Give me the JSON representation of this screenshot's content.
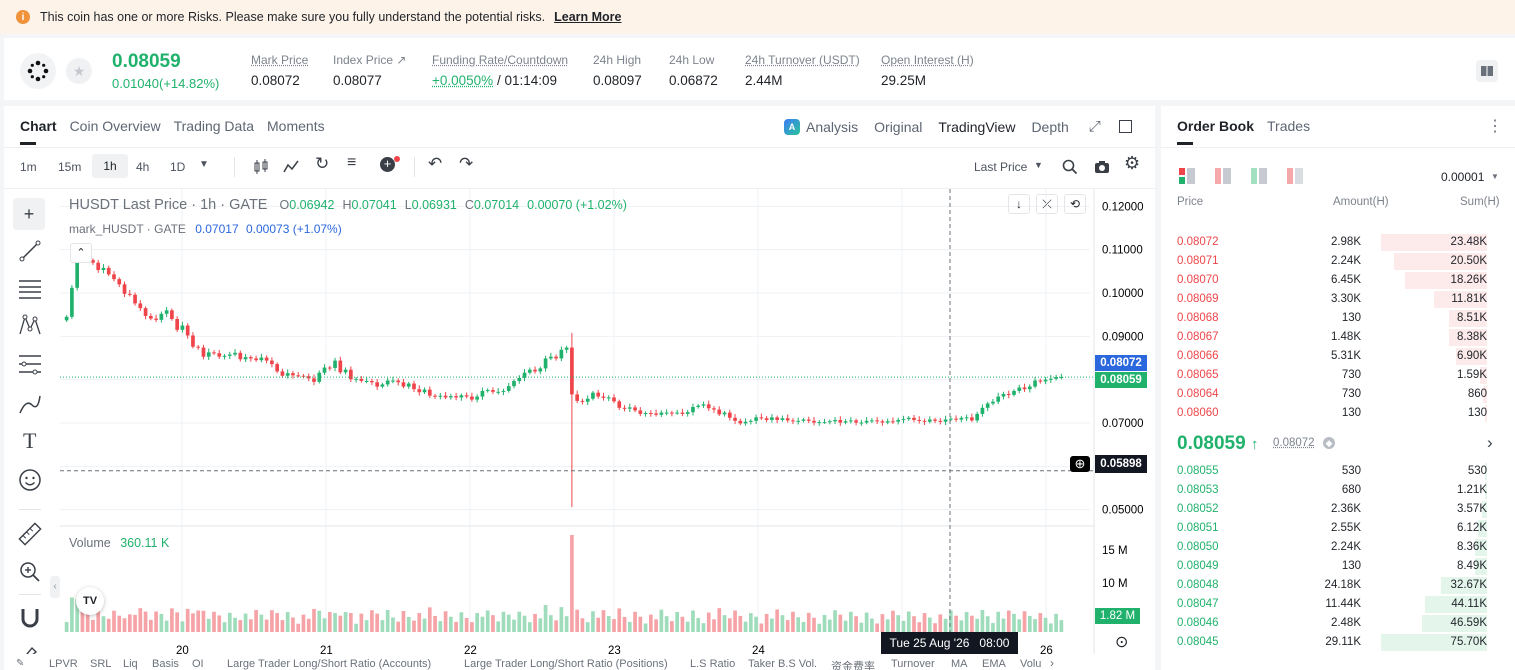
{
  "risk": {
    "text": "This coin has one or more Risks. Please make sure you fully understand the potential risks.",
    "link": "Learn More"
  },
  "ticker": {
    "last": "0.08059",
    "change": "0.01040(+14.82%)",
    "stats": [
      {
        "label": "Mark Price",
        "value": "0.08072"
      },
      {
        "label": "Index Price ↗",
        "value": "0.08077"
      },
      {
        "label": "Funding Rate/Countdown",
        "value": "+0.0050%",
        "value2": " / 01:14:09"
      },
      {
        "label": "24h High",
        "value": "0.08097"
      },
      {
        "label": "24h Low",
        "value": "0.06872"
      },
      {
        "label": "24h Turnover (USDT)",
        "value": "2.44M"
      },
      {
        "label": "Open Interest (H)",
        "value": "29.25M"
      }
    ]
  },
  "tabs": {
    "chart": "Chart",
    "overview": "Coin Overview",
    "trading": "Trading Data",
    "moments": "Moments",
    "analysis": "Analysis",
    "original": "Original",
    "tradingview": "TradingView",
    "depth": "Depth"
  },
  "toolbar": {
    "intervals": [
      "1m",
      "15m",
      "1h",
      "4h",
      "1D"
    ],
    "price_type": "Last Price"
  },
  "chart": {
    "symbol": "HUSDT Last Price · 1h · GATE",
    "o": "0.06942",
    "h": "0.07041",
    "l": "0.06931",
    "c": "0.07014",
    "change": "0.00070 (+1.02%)",
    "mark_label": "mark_HUSDT · GATE",
    "mark_val": "0.07017",
    "mark_change": "0.00073 (+1.07%)",
    "mark_tag": "0.08072",
    "last_tag": "0.08059",
    "cross_tag": "0.05898",
    "time_tag": "Tue 25 Aug '26   08:00",
    "volume_label": "Volume",
    "volume_val": "360.11 K",
    "vol_tag": "1.82 M"
  },
  "chart_data": {
    "type": "candlestick",
    "x_ticks": [
      "20",
      "21",
      "22",
      "23",
      "24",
      "26"
    ],
    "y_ticks": [
      "0.12000",
      "0.11000",
      "0.10000",
      "0.09000",
      "0.07000",
      "0.05000"
    ],
    "ylim": [
      0.046,
      0.124
    ],
    "closes": [
      0.0945,
      0.1012,
      0.1092,
      0.1084,
      0.1076,
      0.107,
      0.1053,
      0.1058,
      0.1043,
      0.1032,
      0.102,
      0.0998,
      0.0996,
      0.0976,
      0.0965,
      0.0947,
      0.0941,
      0.0938,
      0.0952,
      0.096,
      0.094,
      0.0915,
      0.0925,
      0.0902,
      0.0876,
      0.0874,
      0.0853,
      0.0863,
      0.0861,
      0.0853,
      0.0855,
      0.0858,
      0.0862,
      0.0847,
      0.0852,
      0.0849,
      0.0845,
      0.0851,
      0.0844,
      0.0836,
      0.0819,
      0.0809,
      0.0815,
      0.081,
      0.0809,
      0.0808,
      0.0803,
      0.0795,
      0.0816,
      0.0828,
      0.0827,
      0.0844,
      0.0817,
      0.0823,
      0.0801,
      0.0802,
      0.0797,
      0.0797,
      0.0794,
      0.0784,
      0.0789,
      0.0798,
      0.0798,
      0.0794,
      0.0784,
      0.0791,
      0.0778,
      0.0771,
      0.0777,
      0.0763,
      0.0762,
      0.0763,
      0.0759,
      0.0762,
      0.0759,
      0.0764,
      0.0761,
      0.0754,
      0.0761,
      0.0774,
      0.0776,
      0.0772,
      0.0772,
      0.0774,
      0.0785,
      0.0797,
      0.0804,
      0.0816,
      0.0823,
      0.0819,
      0.0826,
      0.0849,
      0.0853,
      0.0849,
      0.0869,
      0.0874,
      0.0766,
      0.0751,
      0.0749,
      0.0756,
      0.077,
      0.0761,
      0.0758,
      0.0759,
      0.075,
      0.0735,
      0.0733,
      0.0736,
      0.0729,
      0.0721,
      0.0723,
      0.0722,
      0.0719,
      0.0724,
      0.0724,
      0.0723,
      0.0724,
      0.0721,
      0.0725,
      0.0737,
      0.074,
      0.0743,
      0.0734,
      0.0731,
      0.072,
      0.0724,
      0.0712,
      0.0705,
      0.0699,
      0.0703,
      0.0705,
      0.0713,
      0.0711,
      0.0707,
      0.0713,
      0.0707,
      0.0711,
      0.0706,
      0.0704,
      0.0705,
      0.0708,
      0.0705,
      0.0701,
      0.0702,
      0.0702,
      0.0704,
      0.0707,
      0.0701,
      0.0704,
      0.0706,
      0.0701,
      0.0701,
      0.0705,
      0.0706,
      0.0704,
      0.0701,
      0.0704,
      0.0703,
      0.0707,
      0.0709,
      0.0712,
      0.0707,
      0.0705,
      0.0703,
      0.0708,
      0.0705,
      0.0703,
      0.0708,
      0.071,
      0.0708,
      0.0712,
      0.0713,
      0.0706,
      0.0721,
      0.0735,
      0.0745,
      0.0749,
      0.0761,
      0.0767,
      0.0765,
      0.0774,
      0.0782,
      0.0778,
      0.0784,
      0.0798,
      0.0796,
      0.08,
      0.0802,
      0.0806,
      0.0806
    ]
  },
  "orderbook": {
    "tab": "Order Book",
    "trades": "Trades",
    "precision": "0.00001",
    "cols": [
      "Price",
      "Amount(H)",
      "Sum(H)"
    ],
    "asks": [
      [
        "0.08072",
        "2.98K",
        "23.48K"
      ],
      [
        "0.08071",
        "2.24K",
        "20.50K"
      ],
      [
        "0.08070",
        "6.45K",
        "18.26K"
      ],
      [
        "0.08069",
        "3.30K",
        "11.81K"
      ],
      [
        "0.08068",
        "130",
        "8.51K"
      ],
      [
        "0.08067",
        "1.48K",
        "8.38K"
      ],
      [
        "0.08066",
        "5.31K",
        "6.90K"
      ],
      [
        "0.08065",
        "730",
        "1.59K"
      ],
      [
        "0.08064",
        "730",
        "860"
      ],
      [
        "0.08060",
        "130",
        "130"
      ]
    ],
    "last": "0.08059",
    "mark": "0.08072",
    "bids": [
      [
        "0.08055",
        "530",
        "530"
      ],
      [
        "0.08053",
        "680",
        "1.21K"
      ],
      [
        "0.08052",
        "2.36K",
        "3.57K"
      ],
      [
        "0.08051",
        "2.55K",
        "6.12K"
      ],
      [
        "0.08050",
        "2.24K",
        "8.36K"
      ],
      [
        "0.08049",
        "130",
        "8.49K"
      ],
      [
        "0.08048",
        "24.18K",
        "32.67K"
      ],
      [
        "0.08047",
        "11.44K",
        "44.11K"
      ],
      [
        "0.08046",
        "2.48K",
        "46.59K"
      ],
      [
        "0.08045",
        "29.11K",
        "75.70K"
      ]
    ]
  },
  "bottom_bar": [
    "LPVR",
    "SRL",
    "Liq",
    "Basis",
    "OI",
    "Large Trader Long/Short Ratio (Accounts)",
    "Large Trader Long/Short Ratio (Positions)",
    "L.S Ratio",
    "Taker B.S Vol.",
    "资金费率",
    "Turnover",
    "MA",
    "EMA",
    "Volu"
  ],
  "colors": {
    "up": "#20b26c",
    "down": "#ef454a",
    "accent": "#2b67dd"
  }
}
